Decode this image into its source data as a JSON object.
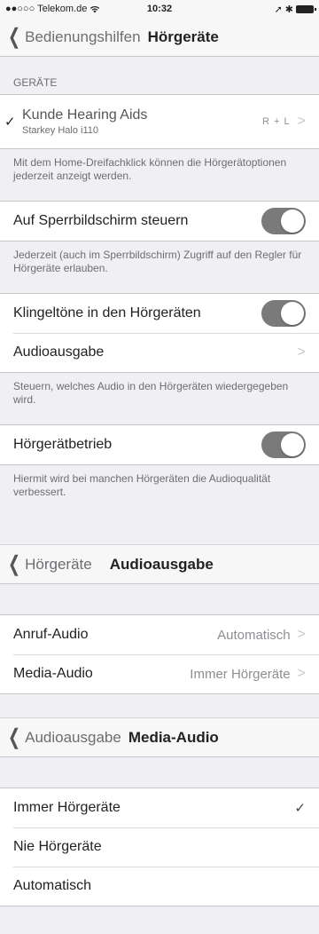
{
  "status": {
    "carrier": "●●○○○ Telekom.de",
    "wifi": "wifi-icon",
    "time": "10:32",
    "icons": "location-icon bluetooth-icon battery-icon"
  },
  "screen1": {
    "back": "Bedienungshilfen",
    "title": "Hörgeräte",
    "devices_header": "GERÄTE",
    "device": {
      "name": "Kunde Hearing Aids",
      "model": "Starkey Halo i110",
      "value": "R + L"
    },
    "devices_footer": "Mit dem Home-Dreifachklick können die Hörgerätoptionen jederzeit anzeigt werden.",
    "lock_label": "Auf Sperrbildschirm steuern",
    "lock_on": true,
    "lock_footer": "Jederzeit (auch im Sperrbildschirm) Zugriff auf den Regler für Hörgeräte erlauben.",
    "ringtones_label": "Klingeltöne in den Hörgeräten",
    "ringtones_on": true,
    "audio_label": "Audioausgabe",
    "audio_footer": "Steuern, welches Audio in den Hörgeräten wiedergegeben wird.",
    "mode_label": "Hörgerätbetrieb",
    "mode_on": true,
    "mode_footer": "Hiermit wird bei manchen Hörgeräten die Audioqualität verbessert."
  },
  "screen2": {
    "back": "Hörgeräte",
    "title": "Audioausgabe",
    "rows": [
      {
        "label": "Anruf-Audio",
        "value": "Automatisch"
      },
      {
        "label": "Media-Audio",
        "value": "Immer Hörgeräte"
      }
    ]
  },
  "screen3": {
    "back": "Audioausgabe",
    "title": "Media-Audio",
    "options": [
      {
        "label": "Immer Hörgeräte",
        "selected": true
      },
      {
        "label": "Nie Hörgeräte",
        "selected": false
      },
      {
        "label": "Automatisch",
        "selected": false
      }
    ]
  }
}
